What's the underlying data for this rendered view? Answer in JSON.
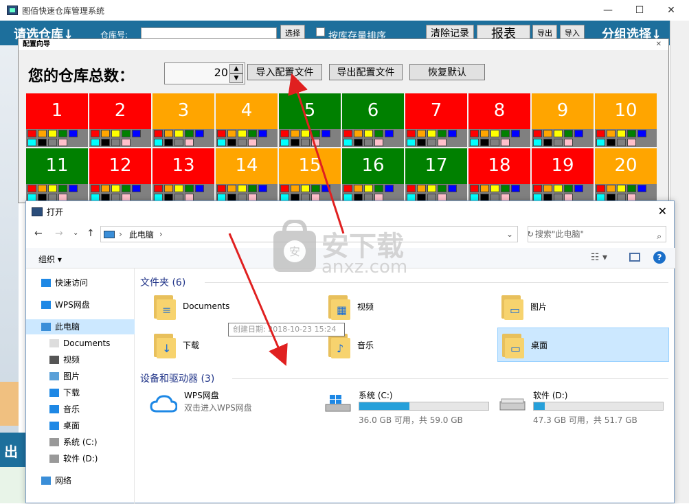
{
  "main_window": {
    "title": "图佰快速仓库管理系统",
    "buttons": {
      "minimize": "—",
      "maximize": "☐",
      "close": "✕"
    },
    "bar": {
      "select_warehouse": "请选仓库↓",
      "warehouse_no_label": "仓库号:",
      "select_btn": "选择",
      "sort_by_stock": "按库存量排序",
      "clear_records": "清除记录",
      "report": "报表",
      "export1": "导出",
      "import1": "导入",
      "group_select": "分组选择↓"
    },
    "bottom_text": "出"
  },
  "config_dialog": {
    "title": "配置向导",
    "close": "✕",
    "heading": "您的仓库总数：",
    "total": "20",
    "import_btn": "导入配置文件",
    "export_btn": "导出配置文件",
    "restore_btn": "恢复默认",
    "warehouses": [
      {
        "num": "1",
        "color": "#ff0000"
      },
      {
        "num": "2",
        "color": "#ff0000"
      },
      {
        "num": "3",
        "color": "#ffa500"
      },
      {
        "num": "4",
        "color": "#ffa500"
      },
      {
        "num": "5",
        "color": "#008000"
      },
      {
        "num": "6",
        "color": "#008000"
      },
      {
        "num": "7",
        "color": "#ff0000"
      },
      {
        "num": "8",
        "color": "#ff0000"
      },
      {
        "num": "9",
        "color": "#ffa500"
      },
      {
        "num": "10",
        "color": "#ffa500"
      },
      {
        "num": "11",
        "color": "#008000"
      },
      {
        "num": "12",
        "color": "#ff0000"
      },
      {
        "num": "13",
        "color": "#ff0000"
      },
      {
        "num": "14",
        "color": "#ffa500"
      },
      {
        "num": "15",
        "color": "#ffa500"
      },
      {
        "num": "16",
        "color": "#008000"
      },
      {
        "num": "17",
        "color": "#008000"
      },
      {
        "num": "18",
        "color": "#ff0000"
      },
      {
        "num": "19",
        "color": "#ff0000"
      },
      {
        "num": "20",
        "color": "#ffa500"
      }
    ],
    "swatch_row1": [
      "#ff0000",
      "#ffa500",
      "#ffff00",
      "#008000",
      "#0000ff"
    ],
    "swatch_row2": [
      "#00ffff",
      "#000000",
      "#808080",
      "#ffc0cb"
    ]
  },
  "file_dialog": {
    "title": "打开",
    "close": "✕",
    "path": "此电脑",
    "search_placeholder": "搜索\"此电脑\"",
    "organize": "组织 ▾",
    "sidebar": [
      {
        "label": "快速访问",
        "icon": "star-icon"
      },
      {
        "label": "WPS网盘",
        "icon": "cloud-icon"
      },
      {
        "label": "此电脑",
        "icon": "computer-icon"
      },
      {
        "label": "Documents",
        "icon": "document-icon"
      },
      {
        "label": "视频",
        "icon": "video-icon"
      },
      {
        "label": "图片",
        "icon": "picture-icon"
      },
      {
        "label": "下载",
        "icon": "download-icon"
      },
      {
        "label": "音乐",
        "icon": "music-icon"
      },
      {
        "label": "桌面",
        "icon": "desktop-icon"
      },
      {
        "label": "系统 (C:)",
        "icon": "drive-icon"
      },
      {
        "label": "软件 (D:)",
        "icon": "drive-icon"
      },
      {
        "label": "网络",
        "icon": "network-icon"
      }
    ],
    "folders_group": "文件夹 (6)",
    "folders": [
      {
        "label": "Documents",
        "mark": "≡"
      },
      {
        "label": "视频",
        "mark": "▦"
      },
      {
        "label": "图片",
        "mark": "▭"
      },
      {
        "label": "下载",
        "mark": "↓"
      },
      {
        "label": "音乐",
        "mark": "♪"
      },
      {
        "label": "桌面",
        "mark": "▭"
      }
    ],
    "devices_group": "设备和驱动器 (3)",
    "wps": {
      "name": "WPS网盘",
      "desc": "双击进入WPS网盘"
    },
    "drives": [
      {
        "name": "系统 (C:)",
        "size": "36.0 GB 可用，共 59.0 GB",
        "used_fraction": 0.39
      },
      {
        "name": "软件 (D:)",
        "size": "47.3 GB 可用，共 51.7 GB",
        "used_fraction": 0.085
      }
    ],
    "tooltip": "创建日期: 2018-10-23 15:24"
  },
  "watermark": {
    "text": "安下载",
    "sub": "anxz.com"
  },
  "colors": {
    "accent": "#1d6f9c",
    "annotation": "#e02020"
  }
}
